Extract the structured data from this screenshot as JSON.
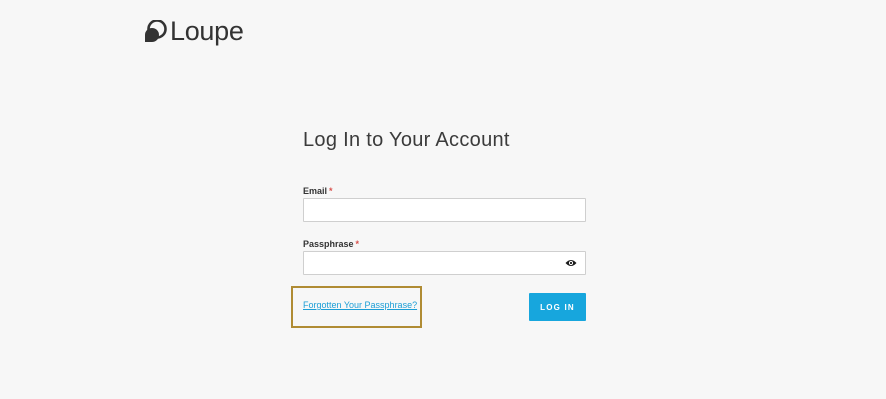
{
  "brand": {
    "name": "Loupe",
    "logo_icon": "loupe-bubble-icon"
  },
  "login_form": {
    "title": "Log In to Your Account",
    "email": {
      "label": "Email",
      "required_marker": "*",
      "value": "",
      "placeholder": ""
    },
    "passphrase": {
      "label": "Passphrase",
      "required_marker": "*",
      "value": "",
      "placeholder": "",
      "toggle_icon": "eye-icon"
    },
    "forgot_link": "Forgotten Your Passphrase?",
    "submit_label": "LOG IN"
  },
  "colors": {
    "accent": "#17a6dd",
    "link": "#1c9ed6",
    "required": "#d9534f",
    "highlight_frame": "#b08c34",
    "background": "#f7f7f7"
  }
}
